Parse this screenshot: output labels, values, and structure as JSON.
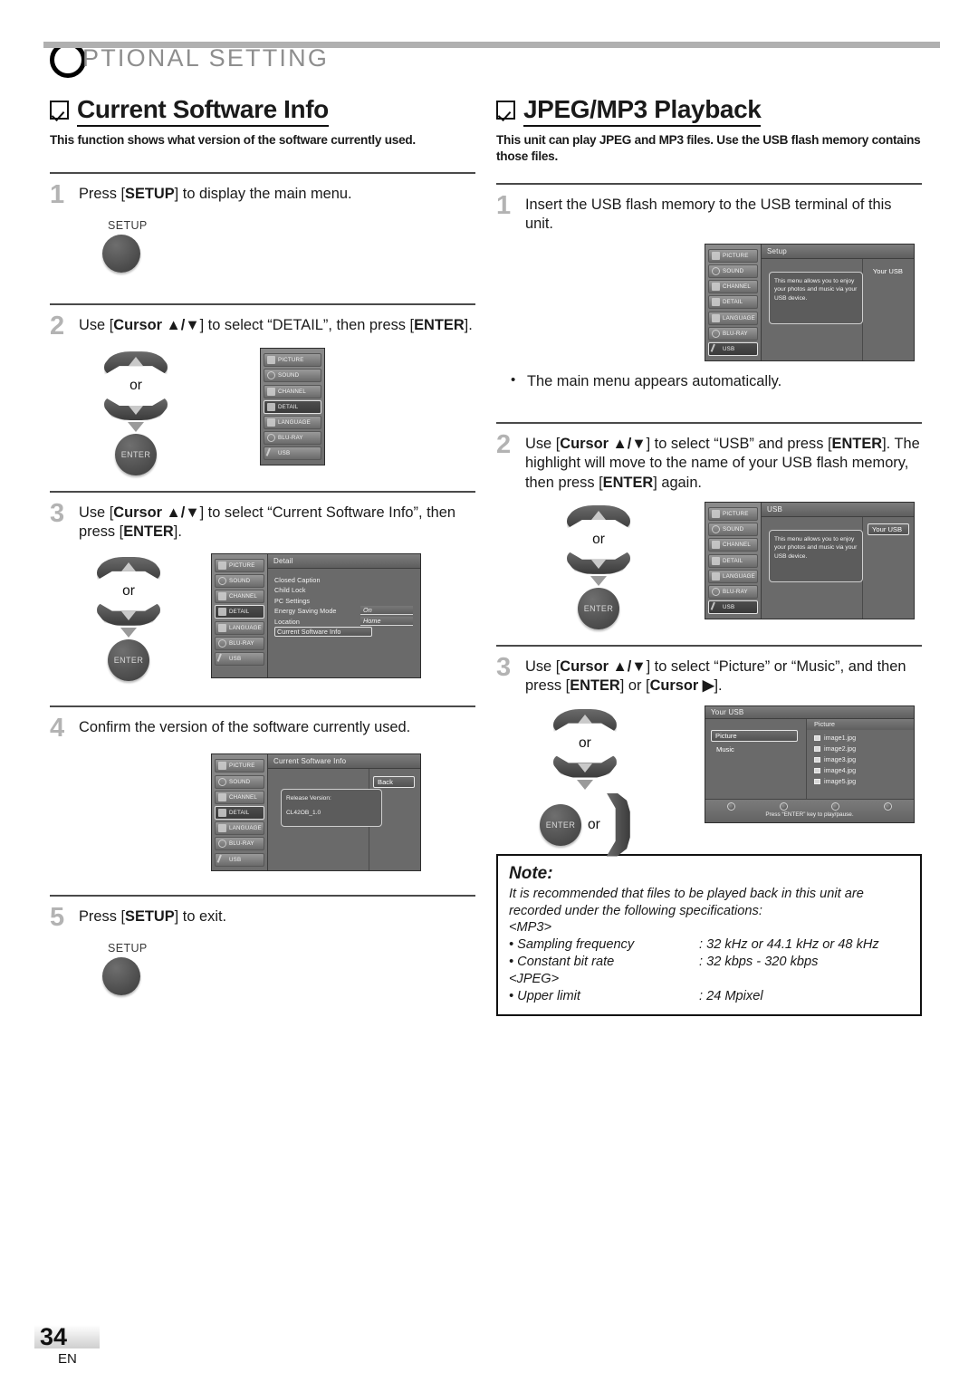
{
  "chapter": {
    "initial": "O",
    "title": "PTIONAL  SETTING"
  },
  "footer": {
    "page": "34",
    "lang": "EN"
  },
  "left": {
    "heading": "Current Software Info",
    "description": "This function shows what version of the software currently used.",
    "steps": [
      {
        "num": "1",
        "text_html": "Press [<b>SETUP</b>] to display the main menu."
      },
      {
        "num": "2",
        "text_html": "Use [<b>Cursor ▲/▼</b>] to select “DETAIL”, then press [<b>ENTER</b>]."
      },
      {
        "num": "3",
        "text_html": "Use [<b>Cursor ▲/▼</b>] to select “Current Software Info”, then press [<b>ENTER</b>]."
      },
      {
        "num": "4",
        "text_html": "Confirm the version of the software currently used."
      },
      {
        "num": "5",
        "text_html": "Press [<b>SETUP</b>] to exit."
      }
    ],
    "setup_button_label": "SETUP",
    "enter_button_label": "ENTER",
    "or_label": "or"
  },
  "right": {
    "heading": "JPEG/MP3 Playback",
    "description": "This unit can play JPEG and MP3 files. Use the USB flash memory contains those files.",
    "steps": [
      {
        "num": "1",
        "text_html": "Insert the USB flash memory to the USB terminal of this unit."
      },
      {
        "num": "2",
        "text_html": "Use [<b>Cursor ▲/▼</b>] to select “USB” and press [<b>ENTER</b>]. The highlight will move to the name of your USB flash memory, then press [<b>ENTER</b>] again."
      },
      {
        "num": "3",
        "text_html": "Use [<b>Cursor ▲/▼</b>] to select “Picture” or “Music”, and then press [<b>ENTER</b>] or [<b>Cursor ▶</b>]."
      }
    ],
    "bullet": "The main menu appears automatically.",
    "enter_button_label": "ENTER",
    "or_label": "or"
  },
  "osd": {
    "menu_items": [
      "PICTURE",
      "SOUND",
      "CHANNEL",
      "DETAIL",
      "LANGUAGE",
      "BLU-RAY",
      "USB"
    ],
    "detail_screen": {
      "title": "Detail",
      "rows": [
        {
          "label": "Closed Caption",
          "value": ""
        },
        {
          "label": "Child Lock",
          "value": ""
        },
        {
          "label": "PC Settings",
          "value": ""
        },
        {
          "label": "Energy Saving Mode",
          "value": "On"
        },
        {
          "label": "Location",
          "value": "Home"
        },
        {
          "label": "Current Software Info",
          "value": ""
        }
      ],
      "selected_sidebar": "DETAIL",
      "selected_row": "Current Software Info"
    },
    "software_info_screen": {
      "title": "Current Software Info",
      "back_label": "Back",
      "release_label": "Release Version:",
      "release_value": "CL42OB_1.0",
      "selected_sidebar": "DETAIL"
    },
    "setup_usb_screen": {
      "title": "Setup",
      "info_text": "This menu allows you to enjoy your photos and music via your USB device.",
      "device_label": "Your USB",
      "selected_sidebar": "USB",
      "device_highlighted": false
    },
    "usb_screen": {
      "title": "USB",
      "info_text": "This menu allows you to enjoy your photos and music via your USB device.",
      "device_label": "Your USB",
      "selected_sidebar": "USB",
      "device_highlighted": true
    },
    "browser_screen": {
      "title": "Your USB",
      "column_title": "Picture",
      "categories": [
        "Picture",
        "Music"
      ],
      "selected_category": "Picture",
      "files": [
        "image1.jpg",
        "image2.jpg",
        "image3.jpg",
        "image4.jpg",
        "image5.jpg"
      ],
      "foot_text": "Press “ENTER” key to play/pause."
    }
  },
  "note": {
    "title": "Note:",
    "line1": "It is recommended that files to be played back in this unit are",
    "line2": "recorded under the following specifications:",
    "mp3_header": "<MP3>",
    "specs_mp3": [
      {
        "key": "• Sampling frequency",
        "value": ": 32 kHz or 44.1 kHz or 48 kHz"
      },
      {
        "key": "• Constant bit rate",
        "value": ": 32 kbps - 320 kbps"
      }
    ],
    "jpeg_header": "<JPEG>",
    "specs_jpeg": [
      {
        "key": "• Upper limit",
        "value": ": 24 Mpixel"
      }
    ]
  }
}
